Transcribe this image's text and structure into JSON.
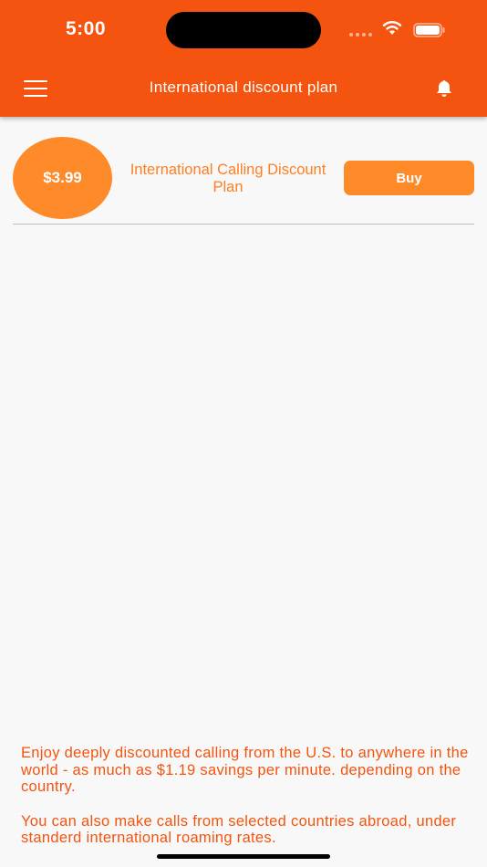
{
  "status_bar": {
    "time": "5:00"
  },
  "header": {
    "title": "International discount plan",
    "menu_icon": "hamburger-menu-icon",
    "notification_icon": "bell-icon",
    "background_color": "#f4540f"
  },
  "plan": {
    "price": "$3.99",
    "name": "International Calling Discount Plan",
    "buy_label": "Buy",
    "accent_color": "#ff8a2a"
  },
  "description": {
    "paragraph_1": "Enjoy deeply discounted calling from the U.S. to anywhere in the world - as much as $1.19 savings per minute. depending on the country.",
    "paragraph_2": "You can also make calls from selected countries abroad, under standerd international roaming rates."
  }
}
